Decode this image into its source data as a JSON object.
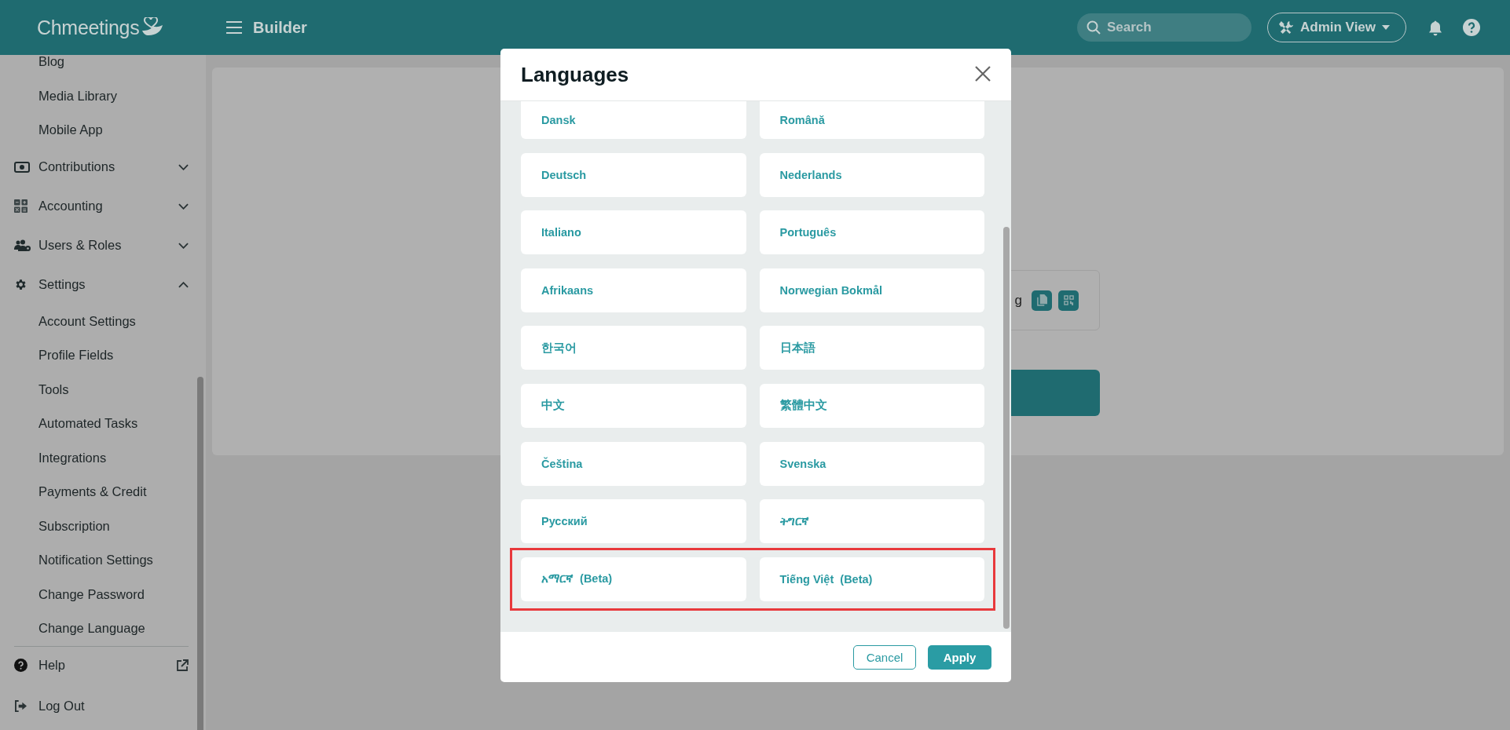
{
  "header": {
    "logo": "Chmeetings",
    "page_title": "Builder",
    "search": {
      "placeholder": "Search"
    },
    "view_button": "Admin View"
  },
  "sidebar": {
    "items": [
      {
        "kind": "link",
        "label": "Blog"
      },
      {
        "kind": "link",
        "label": "Media Library"
      },
      {
        "kind": "link",
        "label": "Mobile App"
      },
      {
        "kind": "group",
        "label": "Contributions",
        "expanded": false
      },
      {
        "kind": "group",
        "label": "Accounting",
        "expanded": false
      },
      {
        "kind": "group",
        "label": "Users & Roles",
        "expanded": false
      },
      {
        "kind": "group",
        "label": "Settings",
        "expanded": true,
        "children": [
          {
            "label": "Account Settings"
          },
          {
            "label": "Profile Fields"
          },
          {
            "label": "Tools"
          },
          {
            "label": "Automated Tasks"
          },
          {
            "label": "Integrations"
          },
          {
            "label": "Payments & Credit"
          },
          {
            "label": "Subscription"
          },
          {
            "label": "Notification Settings"
          },
          {
            "label": "Change Password"
          },
          {
            "label": "Change Language"
          }
        ]
      }
    ],
    "footer": [
      {
        "label": "Help"
      },
      {
        "label": "Log Out"
      }
    ]
  },
  "background": {
    "text": "g"
  },
  "modal": {
    "title": "Languages",
    "rows": [
      {
        "highlighted": false,
        "items": [
          "Dansk",
          "Română"
        ]
      },
      {
        "highlighted": false,
        "items": [
          "Deutsch",
          "Nederlands"
        ]
      },
      {
        "highlighted": false,
        "items": [
          "Italiano",
          "Português"
        ]
      },
      {
        "highlighted": false,
        "items": [
          "Afrikaans",
          "Norwegian Bokmål"
        ]
      },
      {
        "highlighted": false,
        "items": [
          "한국어",
          "日本語"
        ]
      },
      {
        "highlighted": false,
        "items": [
          "中文",
          "繁體中文"
        ]
      },
      {
        "highlighted": false,
        "items": [
          "Čeština",
          "Svenska"
        ]
      },
      {
        "highlighted": false,
        "items": [
          "Русский",
          "ትግርኛ"
        ]
      },
      {
        "highlighted": true,
        "items": [
          "አማርኛ  (Beta)",
          "Tiếng Việt  (Beta)"
        ]
      }
    ],
    "cancel": "Cancel",
    "apply": "Apply"
  }
}
